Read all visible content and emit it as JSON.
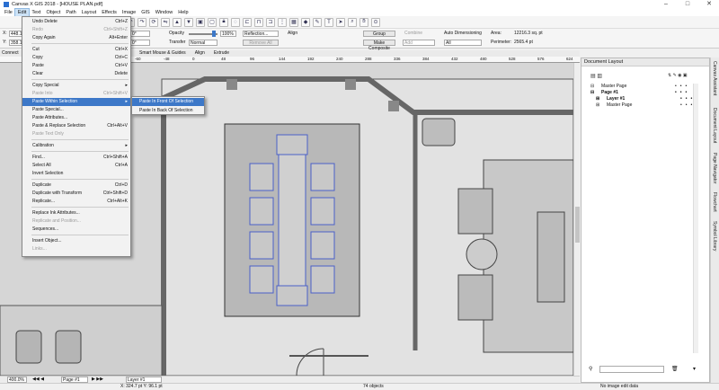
{
  "window": {
    "title": "Canvas X GIS 2018 - [HOUSE PLAN.pdf]",
    "min": "–",
    "max": "□",
    "close": "✕"
  },
  "menubar": [
    "File",
    "Edit",
    "Text",
    "Object",
    "Path",
    "Layout",
    "Effects",
    "Image",
    "GIS",
    "Window",
    "Help"
  ],
  "toolbar2": {
    "x_label": "X:",
    "x_value": "448.1",
    "y_label": "Y:",
    "y_value": "358.1",
    "angle_value": "0°",
    "angle2_value": "0°",
    "opacity_label": "Opacity",
    "opacity_value": "100%",
    "reflection_value": "Reflection...",
    "transfer_label": "Transfer",
    "transfer_value": "Normal",
    "remove_all": "Remove All",
    "align_label": "Align",
    "group_label": "Group",
    "combine_label": "Combine",
    "make_composite": "Make Composite",
    "add_label": "Add",
    "auto_dim_label": "Auto Dimensioning",
    "auto_dim_value": "All",
    "area_label": "Area:",
    "area_value": "12216.3 sq. pt",
    "perimeter_label": "Perimeter:",
    "perimeter_value": "2565.4 pt"
  },
  "tabs": [
    "Smart Mouse & Guides",
    "Align",
    "Extrude"
  ],
  "connect_label": "Connect",
  "ruler": [
    "-60",
    "-48",
    "0",
    "48",
    "96",
    "144",
    "192",
    "240",
    "288",
    "336",
    "384",
    "432",
    "480",
    "528",
    "576",
    "624"
  ],
  "edit_menu": {
    "items": [
      {
        "label": "Undo Delete",
        "shortcut": "Ctrl+Z",
        "disabled": false
      },
      {
        "label": "Redo",
        "shortcut": "Ctrl+Shift+Z",
        "disabled": true
      },
      {
        "label": "Copy Again",
        "shortcut": "Alt+Enter",
        "disabled": false
      },
      {
        "label": "Cut",
        "shortcut": "Ctrl+X",
        "disabled": false
      },
      {
        "label": "Copy",
        "shortcut": "Ctrl+C",
        "disabled": false
      },
      {
        "label": "Paste",
        "shortcut": "Ctrl+V",
        "disabled": false
      },
      {
        "label": "Clear",
        "shortcut": "Delete",
        "disabled": false
      },
      {
        "label": "Copy Special",
        "shortcut": "",
        "disabled": false,
        "submenu": true
      },
      {
        "label": "Paste Into",
        "shortcut": "Ctrl+Shift+V",
        "disabled": true
      },
      {
        "label": "Paste Within Selection",
        "shortcut": "",
        "disabled": false,
        "submenu": true,
        "highlight": true
      },
      {
        "label": "Paste Special...",
        "shortcut": "",
        "disabled": false
      },
      {
        "label": "Paste Attributes...",
        "shortcut": "",
        "disabled": false
      },
      {
        "label": "Paste & Replace Selection",
        "shortcut": "Ctrl+Alt+V",
        "disabled": false
      },
      {
        "label": "Paste Text Only",
        "shortcut": "",
        "disabled": true
      },
      {
        "label": "Calibration",
        "shortcut": "",
        "disabled": false,
        "submenu": true
      },
      {
        "label": "Find...",
        "shortcut": "Ctrl+Shift+A",
        "disabled": false
      },
      {
        "label": "Select All",
        "shortcut": "Ctrl+A",
        "disabled": false
      },
      {
        "label": "Invert Selection",
        "shortcut": "",
        "disabled": false
      },
      {
        "label": "Duplicate",
        "shortcut": "Ctrl+D",
        "disabled": false
      },
      {
        "label": "Duplicate with Transform",
        "shortcut": "Ctrl+Shift+D",
        "disabled": false
      },
      {
        "label": "Replicate...",
        "shortcut": "Ctrl+Alt+K",
        "disabled": false
      },
      {
        "label": "Replace Ink Attributes...",
        "shortcut": "",
        "disabled": false
      },
      {
        "label": "Replicate and Position...",
        "shortcut": "",
        "disabled": true
      },
      {
        "label": "Sequences...",
        "shortcut": "",
        "disabled": false
      },
      {
        "label": "Insert Object...",
        "shortcut": "",
        "disabled": false
      },
      {
        "label": "Links...",
        "shortcut": "",
        "disabled": true
      }
    ]
  },
  "submenu": [
    "Paste In Front Of Selection",
    "Paste In Back Of Selection"
  ],
  "doc_layout": {
    "title": "Document Layout",
    "rows": [
      "Master Page",
      "Page #1",
      "Layer #1",
      "Master Page"
    ]
  },
  "side_tabs": [
    "Canvas Assistant",
    "Document Layout",
    "Page Navigator",
    "Flowchart",
    "Symbol Library"
  ],
  "status": {
    "zoom": "400.0%",
    "page": "Page #1",
    "layer": "Layer #1",
    "coords": "X: 324.7 pt Y: 96.1 pt",
    "objects": "74 objects",
    "edit": "No image edit data"
  }
}
